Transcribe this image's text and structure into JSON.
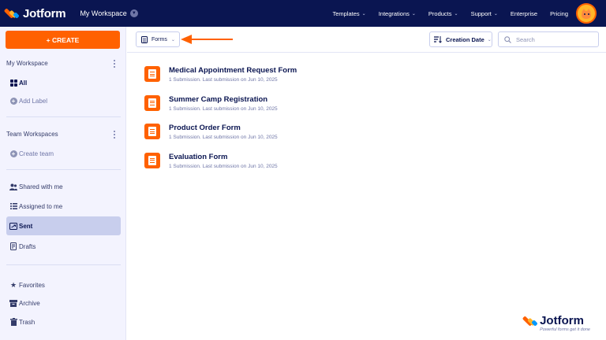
{
  "app": {
    "brand_name": "Jotform",
    "workspace_label": "My Workspace",
    "accent": "#ff6100",
    "navy": "#0a1551"
  },
  "topnav": {
    "items": [
      {
        "label": "Templates",
        "icon": "chevron-down-icon"
      },
      {
        "label": "Integrations",
        "icon": "chevron-down-icon"
      },
      {
        "label": "Products",
        "icon": "chevron-down-icon"
      },
      {
        "label": "Support",
        "icon": "chevron-down-icon"
      },
      {
        "label": "Enterprise"
      },
      {
        "label": "Pricing"
      }
    ],
    "avatar_icon": "cat-avatar-icon"
  },
  "sidebar": {
    "create_label": "+ CREATE",
    "my_workspace_heading": "My Workspace",
    "all_label": "All",
    "add_label": "Add Label",
    "team_heading": "Team Workspaces",
    "create_team": "Create team",
    "shared_with_me": "Shared with me",
    "assigned_to_me": "Assigned to me",
    "sent": "Sent",
    "drafts": "Drafts",
    "favorites": "Favorites",
    "archive": "Archive",
    "trash": "Trash"
  },
  "toolbar": {
    "forms_dropdown": "Forms",
    "sort_label": "Creation Date",
    "search_placeholder": "Search"
  },
  "forms": [
    {
      "title": "Medical Appointment Request Form",
      "meta": "1 Submission. Last submission on Jun 10, 2025"
    },
    {
      "title": "Summer Camp Registration",
      "meta": "1 Submission. Last submission on Jun 10, 2025"
    },
    {
      "title": "Product Order Form",
      "meta": "1 Submission. Last submission on Jun 10, 2025"
    },
    {
      "title": "Evaluation Form",
      "meta": "1 Submission. Last submission on Jun 10, 2025"
    }
  ],
  "watermark": {
    "name": "Jotform",
    "tagline": "Powerful forms get it done"
  }
}
